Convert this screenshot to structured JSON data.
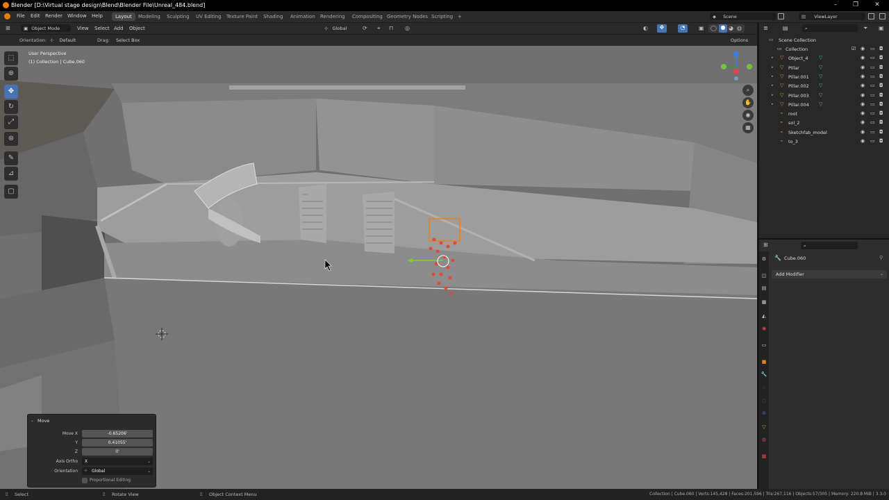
{
  "window": {
    "title": "Blender [D:\\Virtual stage design\\Blend\\Blender File\\Unreal_484.blend]",
    "controls": [
      "–",
      "❐",
      "✕"
    ]
  },
  "menu": {
    "items": [
      "File",
      "Edit",
      "Render",
      "Window",
      "Help"
    ],
    "workspaces": [
      "Layout",
      "Modeling",
      "Sculpting",
      "UV Editing",
      "Texture Paint",
      "Shading",
      "Animation",
      "Rendering",
      "Compositing",
      "Geometry Nodes",
      "Scripting"
    ],
    "active_workspace": "Layout",
    "add_tab": "+",
    "scene_label": "Scene",
    "viewlayer_label": "ViewLayer"
  },
  "viewport_header": {
    "mode": "Object Mode",
    "menus": [
      "View",
      "Select",
      "Add",
      "Object"
    ],
    "transform": "Global",
    "options": "Options"
  },
  "tool_settings": {
    "orientation_label": "Orientation:",
    "orientation_value": "Default",
    "drag_label": "Drag:",
    "drag_value": "Select Box"
  },
  "viewport": {
    "perspective": "User Perspective",
    "context": "(1) Collection | Cube.060"
  },
  "operator_panel": {
    "title": "Move",
    "move_x_label": "Move X",
    "move_x": "-0.65206'",
    "y_label": "Y",
    "y": "0.41055'",
    "z_label": "Z",
    "z": "0'",
    "axis_ortho_label": "Axis Ortho",
    "axis_ortho": "X",
    "orientation_label": "Orientation",
    "orientation": "Global",
    "proportional": "Proportional Editing"
  },
  "outliner": {
    "root": "Scene Collection",
    "rows": [
      {
        "name": "Collection",
        "type": "collection"
      },
      {
        "name": "Object_4",
        "type": "mesh"
      },
      {
        "name": "Pillar",
        "type": "mesh"
      },
      {
        "name": "Pillar.001",
        "type": "mesh"
      },
      {
        "name": "Pillar.002",
        "type": "mesh"
      },
      {
        "name": "Pillar.003",
        "type": "mesh"
      },
      {
        "name": "Pillar.004",
        "type": "mesh"
      },
      {
        "name": "root",
        "type": "empty"
      },
      {
        "name": "sol_2",
        "type": "empty"
      },
      {
        "name": "Sketchfab_model",
        "type": "empty"
      },
      {
        "name": "to_3",
        "type": "empty"
      }
    ]
  },
  "properties": {
    "object_name": "Cube.060",
    "add_modifier": "Add Modifier"
  },
  "statusbar": {
    "select": "Select",
    "rotate": "Rotate View",
    "context_menu": "Object Context Menu",
    "stats": "Collection | Cube.060 | Verts:145,428 | Faces:201,596 | Tris:267,116 | Objects:57/305 | Memory: 220.8 MiB | 3.3.0"
  },
  "colors": {
    "accent": "#4772b3",
    "selection_orange": "#e8811c",
    "viewport_bg": "#6f6f6f",
    "panel_bg": "#2b2b2b"
  }
}
